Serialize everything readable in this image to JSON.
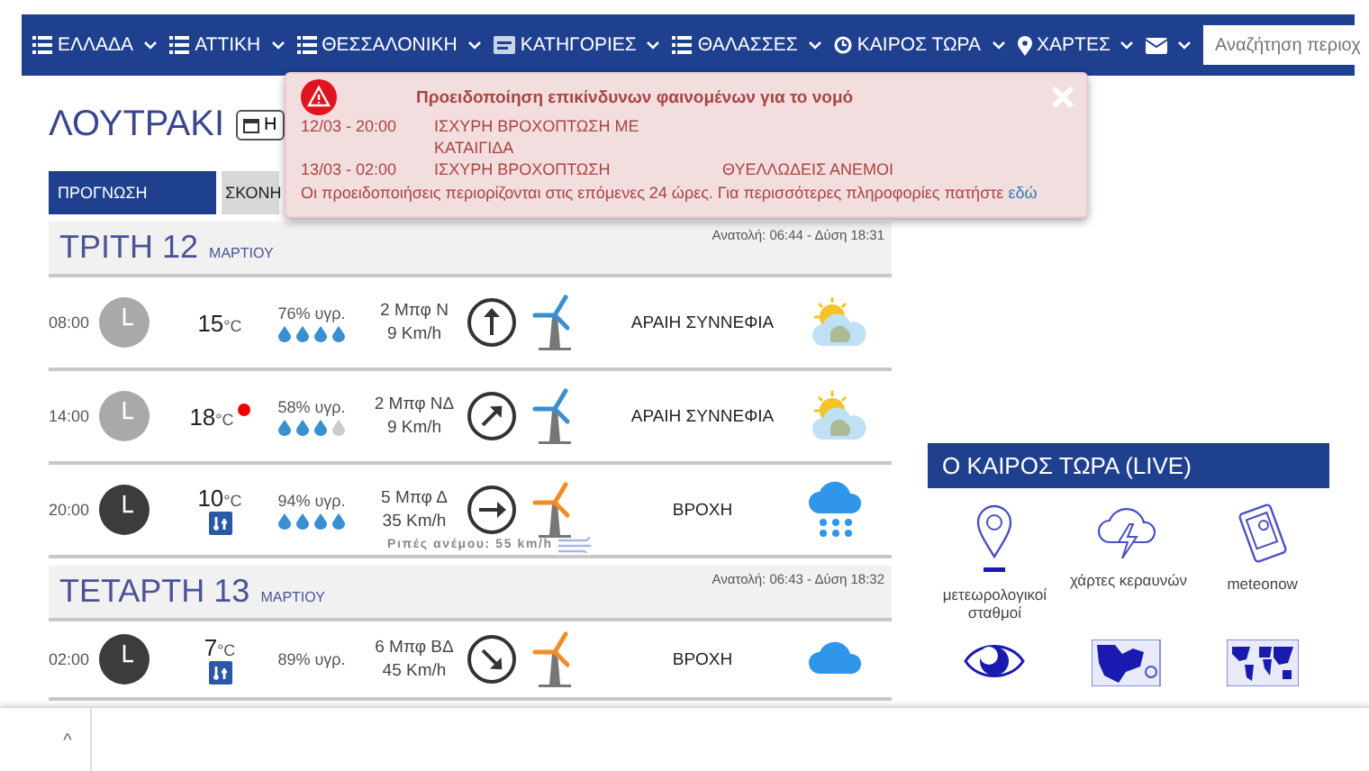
{
  "nav": {
    "items": [
      {
        "label": "ΕΛΛΑΔΑ",
        "kind": "list"
      },
      {
        "label": "ΑΤΤΙΚΗ",
        "kind": "list"
      },
      {
        "label": "ΘΕΣΣΑΛΟΝΙΚΗ",
        "kind": "list"
      },
      {
        "label": "ΚΑΤΗΓΟΡΙΕΣ",
        "kind": "card"
      },
      {
        "label": "ΘΑΛΑΣΣΕΣ",
        "kind": "list"
      },
      {
        "label": "ΚΑΙΡΟΣ ΤΩΡΑ",
        "kind": "clock"
      },
      {
        "label": "ΧΑΡΤΕΣ",
        "kind": "pin"
      },
      {
        "kind": "mail"
      }
    ],
    "search": {
      "placeholder": "Αναζήτηση περιοχ"
    }
  },
  "page_title": "ΛΟΥΤΡΑΚΙ",
  "date_button": "Η",
  "tabs": [
    {
      "label": "ΠΡΟΓΝΩΣΗ",
      "selected": true
    },
    {
      "label": "ΣΚΟΝΗ",
      "selected": false
    }
  ],
  "days": [
    {
      "name": "ΤΡΙΤΗ 12",
      "month": "ΜΑΡΤΙΟΥ",
      "sun": "Ανατολή: 06:44 - Δύση 18:31",
      "rows": [
        {
          "time": "08:00",
          "night": false,
          "temp": "15",
          "unit": "°C",
          "alert": false,
          "feels": false,
          "humidity": "76% υγρ.",
          "stars": 4,
          "wind": "2 Μπφ Ν",
          "speed": "9 Km/h",
          "arrow": {
            "kind": "up"
          },
          "color": "#3a8fd0",
          "condition": "ΑΡΑΙΗ ΣΥΝΝΕΦΙΑ",
          "kind": "partly_cloudy"
        },
        {
          "time": "14:00",
          "night": false,
          "temp": "18",
          "unit": "°C",
          "alert": true,
          "feels": false,
          "humidity": "58% υγρ.",
          "stars": 3,
          "wind": "2 Μπφ ΝΔ",
          "speed": "9 Km/h",
          "arrow": {
            "kind": "up_right"
          },
          "color": "#3a8fd0",
          "condition": "ΑΡΑΙΗ ΣΥΝΝΕΦΙΑ",
          "kind": "partly_cloudy"
        },
        {
          "time": "20:00",
          "night": true,
          "temp": "10",
          "unit": "°C",
          "alert": false,
          "feels": true,
          "humidity": "94% υγρ.",
          "stars": 4,
          "wind": "5 Μπφ Δ",
          "speed": "35 Km/h",
          "arrow": {
            "kind": "right"
          },
          "color": "#f28c28",
          "gust": "Ριπές ανέμου: 55 km/h",
          "condition": "ΒΡΟΧΗ",
          "kind": "rain"
        }
      ]
    },
    {
      "name": "ΤΕΤΑΡΤΗ 13",
      "month": "ΜΑΡΤΙΟΥ",
      "sun": "Ανατολή: 06:43 - Δύση 18:32",
      "rows": [
        {
          "time": "02:00",
          "night": true,
          "temp": "7",
          "unit": "°C",
          "alert": false,
          "feels": true,
          "humidity": "89% υγρ.",
          "wind": "6 Μπφ ΒΔ",
          "speed": "45 Km/h",
          "arrow": {
            "kind": "down_right"
          },
          "color": "#f28c28",
          "condition": "ΒΡΟΧΗ",
          "kind": "cloud"
        }
      ]
    }
  ],
  "live": {
    "title": "Ο ΚΑΙΡΟΣ ΤΩΡΑ (LIVE)",
    "items": [
      {
        "kind": "pin",
        "label": "μετεωρολογικοί σταθμοί"
      },
      {
        "kind": "storm",
        "label": "χάρτες κεραυνών"
      },
      {
        "kind": "tablet",
        "label": "meteonow"
      },
      {
        "kind": "eye"
      },
      {
        "kind": "europe"
      },
      {
        "kind": "world"
      }
    ]
  },
  "alert": {
    "title": "Προειδοποίηση επικίνδυνων φαινομένων για το νομό",
    "entries": [
      {
        "time": "12/03 - 20:00",
        "events": [
          "ΙΣΧΥΡΗ ΒΡΟΧΟΠΤΩΣΗ ΜΕ ΚΑΤΑΙΓΙΔΑ"
        ]
      },
      {
        "time": "13/03 - 02:00",
        "events": [
          "ΙΣΧΥΡΗ ΒΡΟΧΟΠΤΩΣΗ",
          "ΘΥΕΛΛΩΔΕΙΣ ΑΝΕΜΟΙ"
        ]
      }
    ],
    "note": "Οι προειδοποιήσεις περιορίζονται στις επόμενες 24 ώρες. Για περισσότερες πληροφορίες πατήστε",
    "link": "εδώ"
  },
  "bottom_bar": {
    "button": "^"
  }
}
